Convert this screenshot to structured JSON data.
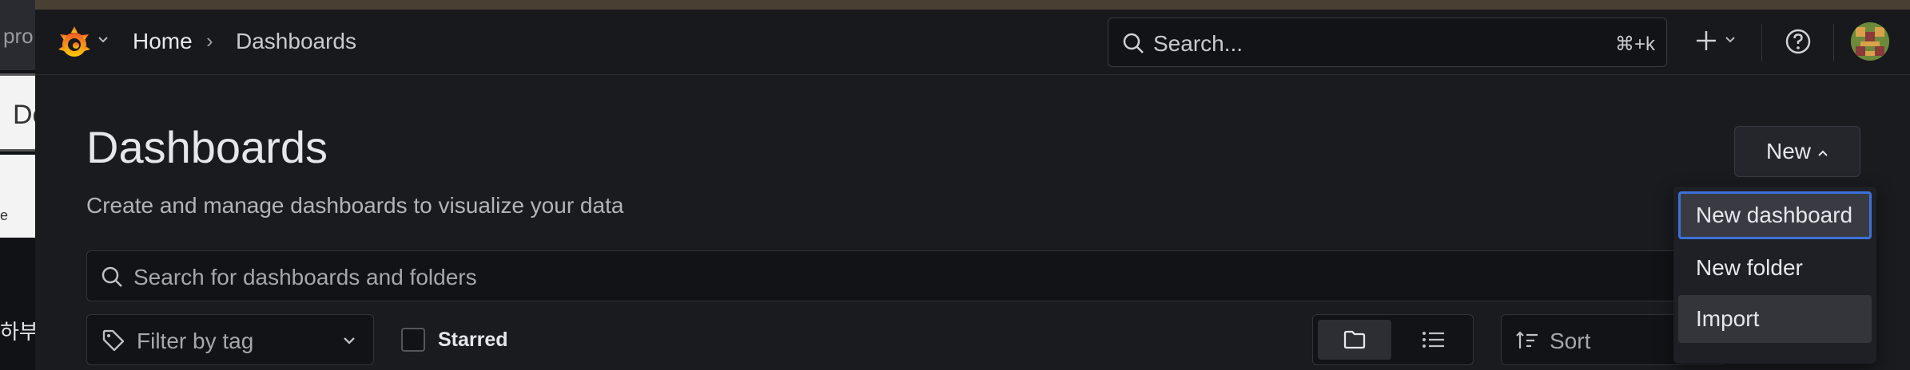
{
  "background_strip": {
    "tab_a": "pro",
    "tab_b": "De",
    "tab_c": "e",
    "tab_d": "하부"
  },
  "breadcrumb": {
    "home": "Home",
    "separator": "›",
    "current": "Dashboards"
  },
  "topbar": {
    "search_placeholder": "Search...",
    "search_shortcut": "⌘+k"
  },
  "page": {
    "title": "Dashboards",
    "subtitle": "Create and manage dashboards to visualize your data",
    "new_button": "New"
  },
  "dashboard_search": {
    "placeholder": "Search for dashboards and folders"
  },
  "filters": {
    "tag_placeholder": "Filter by tag",
    "starred_label": "Starred",
    "starred_checked": false,
    "sort_label": "Sort"
  },
  "view_modes": {
    "selected": "folder",
    "options": [
      "folder",
      "list"
    ]
  },
  "new_menu": {
    "items": [
      "New dashboard",
      "New folder",
      "Import"
    ],
    "focused": "New dashboard"
  },
  "colors": {
    "accent_focus": "#3d71d9",
    "logo_orange": "#f46f2a",
    "logo_yellow": "#fbca0a"
  }
}
